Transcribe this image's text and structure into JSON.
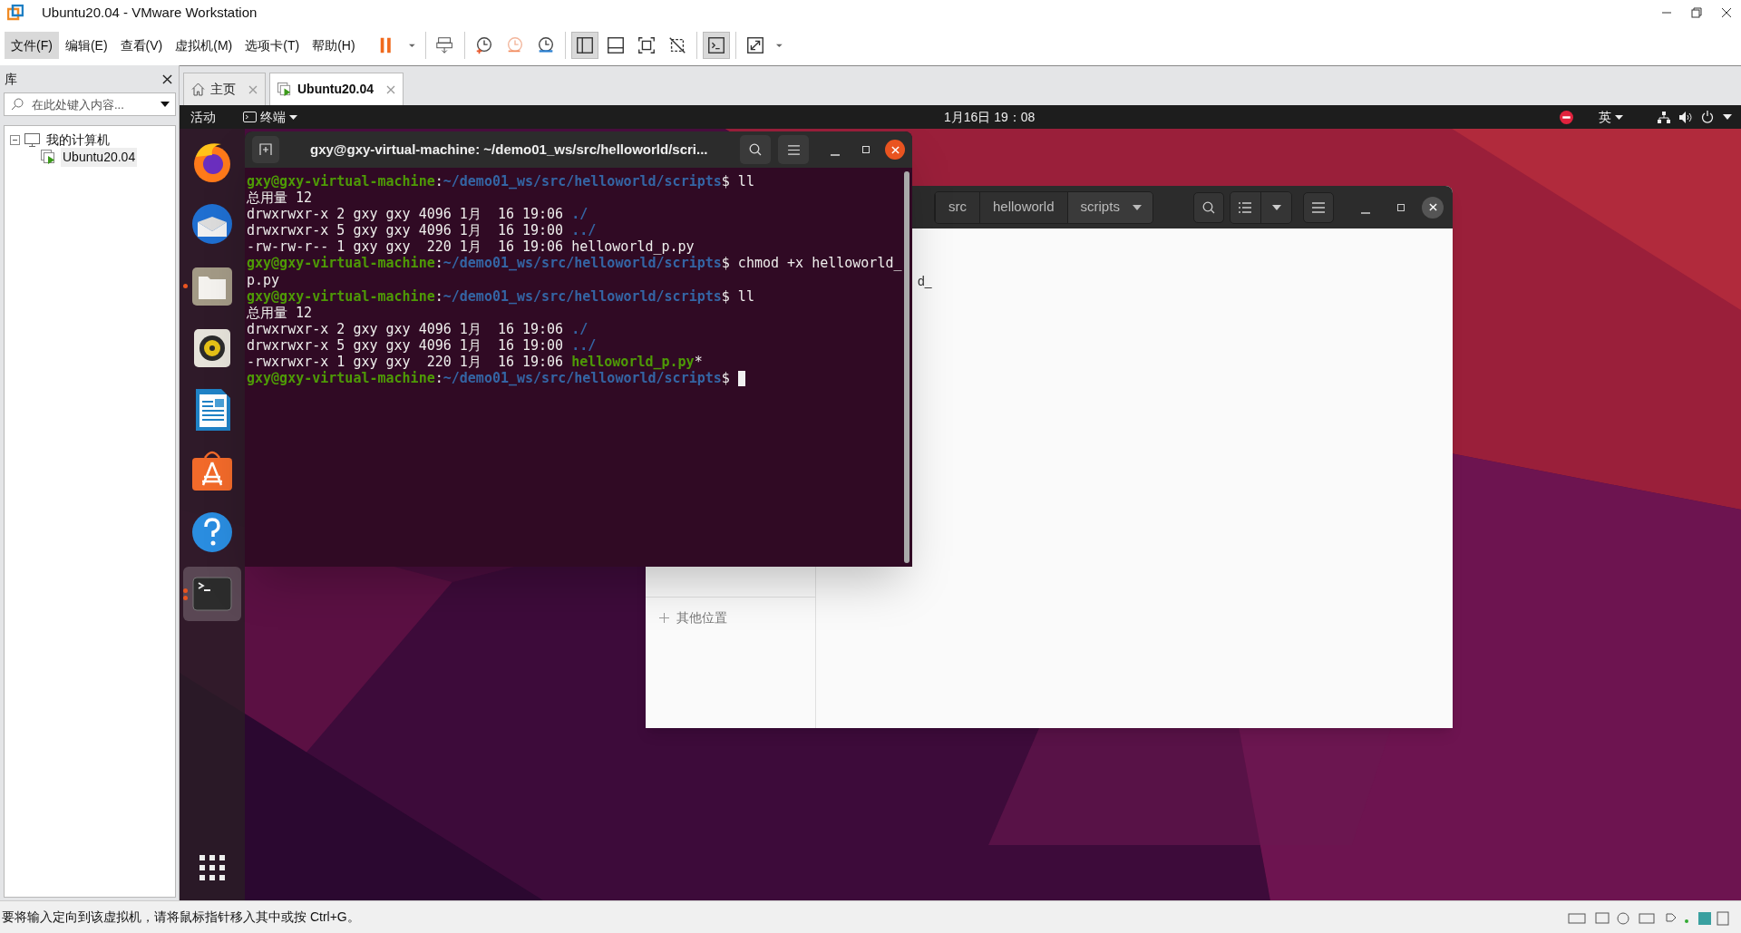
{
  "window": {
    "title": "Ubuntu20.04 - VMware Workstation"
  },
  "menu": [
    {
      "label": "文件(F)",
      "selected": true
    },
    {
      "label": "编辑(E)",
      "selected": false
    },
    {
      "label": "查看(V)",
      "selected": false
    },
    {
      "label": "虚拟机(M)",
      "selected": false
    },
    {
      "label": "选项卡(T)",
      "selected": false
    },
    {
      "label": "帮助(H)",
      "selected": false
    }
  ],
  "toolbar_groups": [
    [
      {
        "kind": "pause",
        "on": false
      },
      {
        "kind": "caret",
        "on": false
      }
    ],
    [
      {
        "kind": "send-keys",
        "on": false
      }
    ],
    [
      {
        "kind": "snapshot",
        "on": false
      },
      {
        "kind": "revert",
        "on": false
      },
      {
        "kind": "manage",
        "on": false
      }
    ],
    [
      {
        "kind": "library",
        "on": true
      },
      {
        "kind": "thumbnails",
        "on": false
      },
      {
        "kind": "fullscreen",
        "on": false
      },
      {
        "kind": "unity",
        "on": false
      }
    ],
    [
      {
        "kind": "console",
        "on": true
      }
    ],
    [
      {
        "kind": "stretch",
        "on": false
      },
      {
        "kind": "caret",
        "on": false
      }
    ]
  ],
  "library": {
    "title": "库",
    "search": {
      "placeholder": "在此处键入内容..."
    },
    "tree": [
      {
        "label": "我的计算机",
        "expanded": true,
        "selected": false,
        "children": [
          {
            "label": "Ubuntu20.04",
            "selected": true
          }
        ]
      }
    ]
  },
  "tabs": [
    {
      "label": "主页",
      "kind": "home",
      "selected": false
    },
    {
      "label": "Ubuntu20.04",
      "kind": "vm",
      "selected": true
    }
  ],
  "ubuntu_bar": {
    "activities": "活动",
    "app": "终端",
    "clock": "1月16日 19：08",
    "input_method": "英"
  },
  "dock": [
    {
      "kind": "firefox",
      "running": false,
      "selected": false
    },
    {
      "kind": "mail",
      "running": false,
      "selected": false
    },
    {
      "kind": "files",
      "running": true,
      "multiple_windows": false,
      "selected": false
    },
    {
      "kind": "speaker",
      "running": false,
      "selected": false
    },
    {
      "kind": "writer",
      "running": false,
      "selected": false
    },
    {
      "kind": "store",
      "running": false,
      "selected": false
    },
    {
      "kind": "help",
      "running": false,
      "selected": false
    },
    {
      "kind": "terminal",
      "running": true,
      "multiple_windows": true,
      "selected": true
    }
  ],
  "terminal": {
    "title": "gxy@gxy-virtual-machine: ~/demo01_ws/src/helloworld/scri...",
    "cursor": true,
    "lines": [
      [
        {
          "kind": "user",
          "text": "gxy@gxy-virtual-machine"
        },
        {
          "kind": "plain",
          "text": ":"
        },
        {
          "kind": "path",
          "text": "~/demo01_ws/src/helloworld/scripts"
        },
        {
          "kind": "plain",
          "text": "$ ll"
        }
      ],
      [
        {
          "kind": "plain",
          "text": "总用量 12"
        }
      ],
      [
        {
          "kind": "plain",
          "text": "drwxrwxr-x 2 gxy gxy 4096 1月  16 19:06 "
        },
        {
          "kind": "dir",
          "text": "./"
        }
      ],
      [
        {
          "kind": "plain",
          "text": "drwxrwxr-x 5 gxy gxy 4096 1月  16 19:00 "
        },
        {
          "kind": "dir",
          "text": "../"
        }
      ],
      [
        {
          "kind": "plain",
          "text": "-rw-rw-r-- 1 gxy gxy  220 1月  16 19:06 helloworld_p.py"
        }
      ],
      [
        {
          "kind": "user",
          "text": "gxy@gxy-virtual-machine"
        },
        {
          "kind": "plain",
          "text": ":"
        },
        {
          "kind": "path",
          "text": "~/demo01_ws/src/helloworld/scripts"
        },
        {
          "kind": "plain",
          "text": "$ chmod +x helloworld_"
        }
      ],
      [
        {
          "kind": "plain",
          "text": "p.py"
        }
      ],
      [
        {
          "kind": "user",
          "text": "gxy@gxy-virtual-machine"
        },
        {
          "kind": "plain",
          "text": ":"
        },
        {
          "kind": "path",
          "text": "~/demo01_ws/src/helloworld/scripts"
        },
        {
          "kind": "plain",
          "text": "$ ll"
        }
      ],
      [
        {
          "kind": "plain",
          "text": "总用量 12"
        }
      ],
      [
        {
          "kind": "plain",
          "text": "drwxrwxr-x 2 gxy gxy 4096 1月  16 19:06 "
        },
        {
          "kind": "dir",
          "text": "./"
        }
      ],
      [
        {
          "kind": "plain",
          "text": "drwxrwxr-x 5 gxy gxy 4096 1月  16 19:00 "
        },
        {
          "kind": "dir",
          "text": "../"
        }
      ],
      [
        {
          "kind": "plain",
          "text": "-rwxrwxr-x 1 gxy gxy  220 1月  16 19:06 "
        },
        {
          "kind": "exec",
          "text": "helloworld_p.py"
        },
        {
          "kind": "plain",
          "text": "*"
        }
      ],
      [
        {
          "kind": "user",
          "text": "gxy@gxy-virtual-machine"
        },
        {
          "kind": "plain",
          "text": ":"
        },
        {
          "kind": "path",
          "text": "~/demo01_ws/src/helloworld/scripts"
        },
        {
          "kind": "plain",
          "text": "$ "
        }
      ]
    ]
  },
  "files": {
    "breadcrumbs": [
      {
        "label": "src",
        "selected": false
      },
      {
        "label": "helloworld",
        "selected": false
      },
      {
        "label": "scripts",
        "selected": true
      }
    ],
    "file_label": "d_",
    "sidebar_items": [
      {
        "label": "其他位置",
        "kind": "add"
      }
    ]
  },
  "status_bar": {
    "text": "要将输入定向到该虚拟机，请将鼠标指针移入其中或按 Ctrl+G。"
  }
}
